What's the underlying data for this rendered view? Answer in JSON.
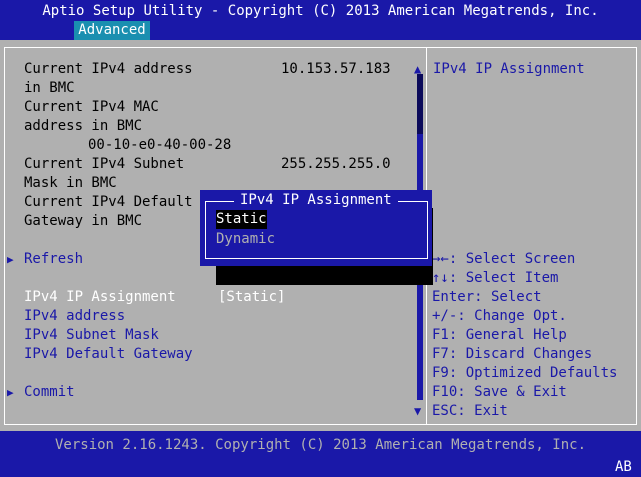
{
  "header": {
    "title": "Aptio Setup Utility - Copyright (C) 2013 American Megatrends, Inc.",
    "active_tab": "Advanced"
  },
  "info": {
    "ipv4_address_label_1": "Current IPv4 address",
    "ipv4_address_label_2": "in BMC",
    "ipv4_address_value": "10.153.57.183",
    "mac_label_1": "Current IPv4 MAC",
    "mac_label_2": "address in BMC",
    "mac_value": "00-10-e0-40-00-28",
    "subnet_label_1": "Current IPv4 Subnet",
    "subnet_label_2": "Mask in BMC",
    "subnet_value": "255.255.255.0",
    "gateway_label_1": "Current IPv4 Default",
    "gateway_label_2": "Gateway in BMC"
  },
  "menu": {
    "refresh": "Refresh",
    "ip_assignment_label": "IPv4 IP Assignment",
    "ip_assignment_value": "[Static]",
    "ipv4_address": "IPv4 address",
    "subnet_mask": "IPv4 Subnet Mask",
    "default_gateway": "IPv4 Default Gateway",
    "commit": "Commit",
    "arrow_glyph": "▶"
  },
  "help": {
    "title": "IPv4 IP Assignment",
    "keys": [
      "→←: Select Screen",
      "↑↓: Select Item",
      "Enter: Select",
      "+/-: Change Opt.",
      "F1: General Help",
      "F7: Discard Changes",
      "F9: Optimized Defaults",
      "F10: Save & Exit",
      "ESC: Exit"
    ]
  },
  "popup": {
    "title": "IPv4 IP Assignment",
    "options": [
      "Static",
      "Dynamic"
    ]
  },
  "scrollbar": {
    "up_glyph": "▲",
    "down_glyph": "▼"
  },
  "footer": {
    "version": "Version 2.16.1243. Copyright (C) 2013 American Megatrends, Inc.",
    "badge": "AB"
  },
  "colors": {
    "bios_blue": "#1a18a8",
    "panel_gray": "#b0b0b0",
    "tab_cyan": "#1a8fb0"
  }
}
